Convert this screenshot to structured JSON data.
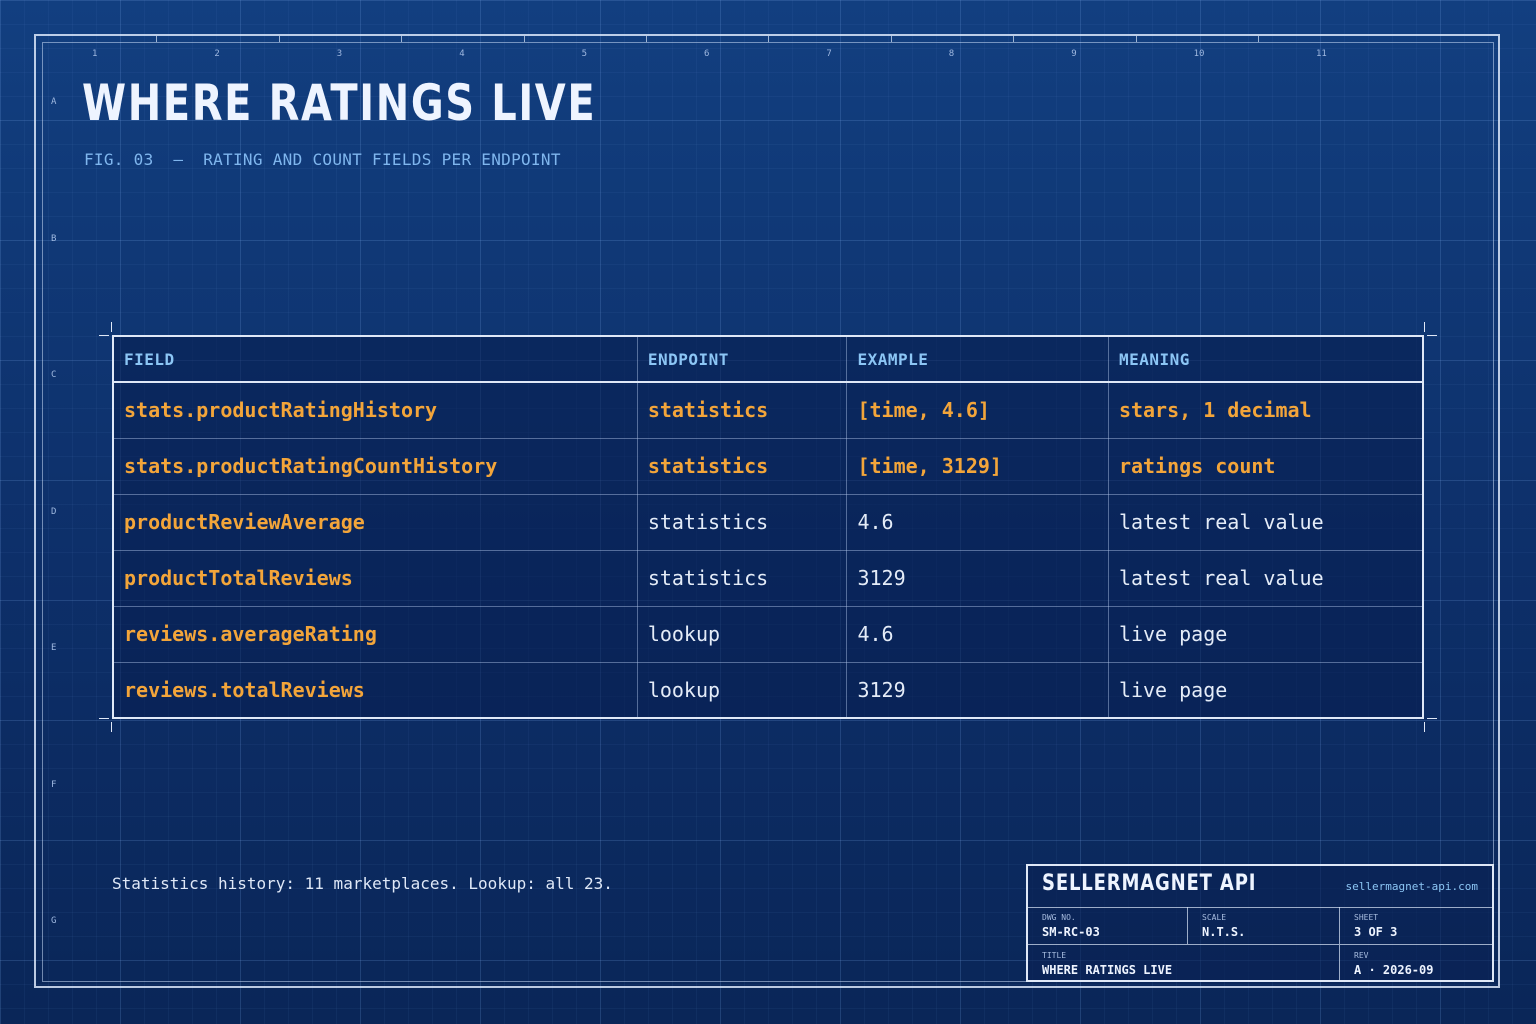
{
  "header": {
    "title": "WHERE RATINGS LIVE",
    "subtitle": "FIG. 03  —  RATING AND COUNT FIELDS PER ENDPOINT"
  },
  "sheet_grid": {
    "columns": [
      "1",
      "2",
      "3",
      "4",
      "5",
      "6",
      "7",
      "8",
      "9",
      "10",
      "11"
    ],
    "rows": [
      "A",
      "B",
      "C",
      "D",
      "E",
      "F",
      "G"
    ]
  },
  "table": {
    "headers": [
      "FIELD",
      "ENDPOINT",
      "EXAMPLE",
      "MEANING"
    ],
    "rows": [
      {
        "field": "stats.productRatingHistory",
        "endpoint": "statistics",
        "example": "[time, 4.6]",
        "meaning": "stars, 1 decimal",
        "highlight": true
      },
      {
        "field": "stats.productRatingCountHistory",
        "endpoint": "statistics",
        "example": "[time, 3129]",
        "meaning": "ratings count",
        "highlight": true
      },
      {
        "field": "productReviewAverage",
        "endpoint": "statistics",
        "example": "4.6",
        "meaning": "latest real value",
        "highlight": false
      },
      {
        "field": "productTotalReviews",
        "endpoint": "statistics",
        "example": "3129",
        "meaning": "latest real value",
        "highlight": false
      },
      {
        "field": "reviews.averageRating",
        "endpoint": "lookup",
        "example": "4.6",
        "meaning": "live page",
        "highlight": false
      },
      {
        "field": "reviews.totalReviews",
        "endpoint": "lookup",
        "example": "3129",
        "meaning": "live page",
        "highlight": false
      }
    ]
  },
  "footer_note": "Statistics history: 11 marketplaces. Lookup: all 23.",
  "title_block": {
    "brand": "SELLERMAGNET API",
    "url": "sellermagnet-api.com",
    "dwg_no_label": "DWG NO.",
    "dwg_no": "SM-RC-03",
    "scale_label": "SCALE",
    "scale": "N.T.S.",
    "sheet_label": "SHEET",
    "sheet": "3 OF 3",
    "title_label": "TITLE",
    "title": "WHERE RATINGS LIVE",
    "rev_label": "REV",
    "rev": "A · 2026-09"
  },
  "colors": {
    "background": "#0f3574",
    "accent_orange": "#f3a53a",
    "header_blue": "#8cc6f5",
    "line": "#dfe8f7"
  }
}
